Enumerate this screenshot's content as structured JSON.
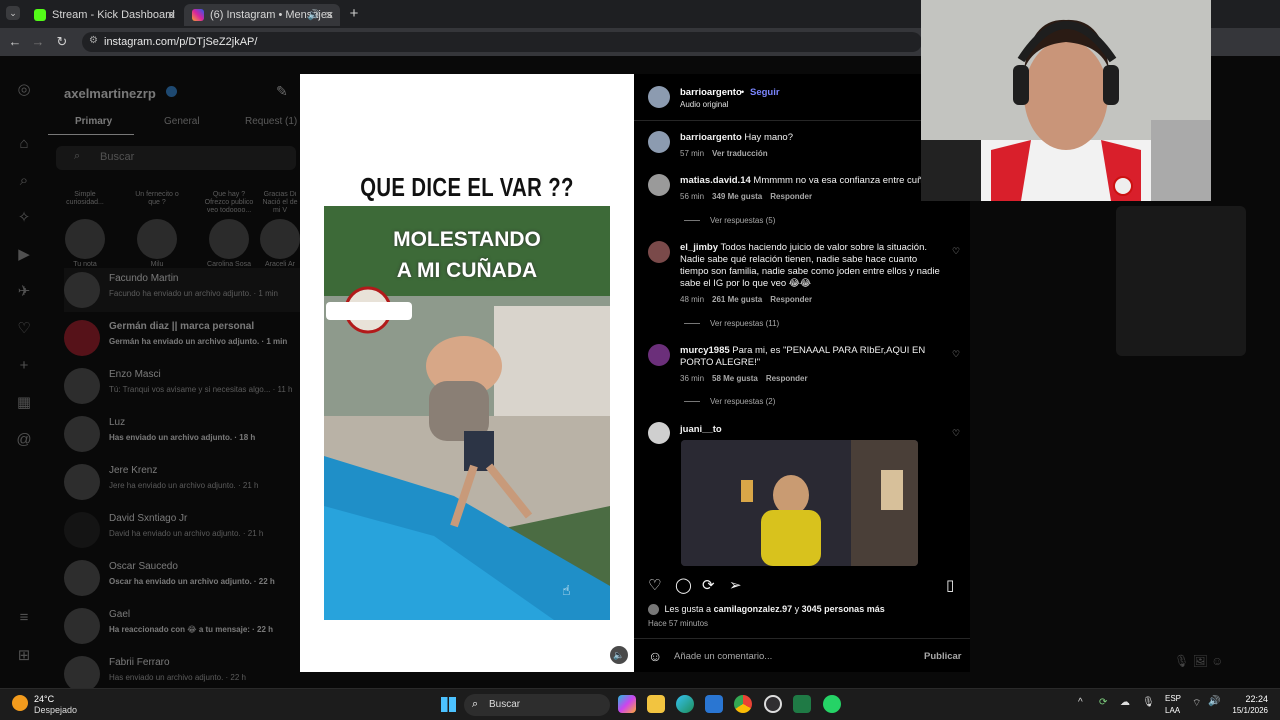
{
  "browser": {
    "tabs": [
      {
        "title": "Stream - Kick Dashboard",
        "active": false,
        "icon_color": "#53fc18"
      },
      {
        "title": "(6) Instagram • Mensajes",
        "active": true,
        "icon_color": "#d6249f"
      }
    ],
    "url": "instagram.com/p/DTjSeZ2jkAP/"
  },
  "dm": {
    "username": "axelmartinezrp",
    "tabs": [
      "Primary",
      "General",
      "Request (1)"
    ],
    "search_placeholder": "Buscar",
    "notes": [
      {
        "text": "Simple curiosidad...",
        "name": "Tu nota"
      },
      {
        "text": "Un fernecito o que ?",
        "name": "Milu"
      },
      {
        "text": "Que hay ? Ofrezco publico veo todoooo...",
        "name": "Carolina Sosa"
      },
      {
        "text": "Gracias Di Nació el de mi V",
        "name": "Araceli Ar"
      }
    ],
    "threads": [
      {
        "name": "Facundo Martin",
        "preview": "Facundo ha enviado un archivo adjunto. · 1 min"
      },
      {
        "name": "Germán diaz || marca personal",
        "preview": "Germán ha enviado un archivo adjunto. · 1 min"
      },
      {
        "name": "Enzo Masci",
        "preview": "Tú: Tranqui vos avisame y si necesitas algo... · 11 h"
      },
      {
        "name": "Luz",
        "preview": "Has enviado un archivo adjunto. · 18 h"
      },
      {
        "name": "Jere Krenz",
        "preview": "Jere ha enviado un archivo adjunto. · 21 h"
      },
      {
        "name": "David Sxntiago Jr",
        "preview": "David ha enviado un archivo adjunto. · 21 h"
      },
      {
        "name": "Oscar Saucedo",
        "preview": "Oscar ha enviado un archivo adjunto. · 22 h"
      },
      {
        "name": "Gael",
        "preview": "Ha reaccionado con 😂 a tu mensaje: · 22 h"
      },
      {
        "name": "Fabrii Ferraro",
        "preview": "Has enviado un archivo adjunto. · 22 h"
      }
    ]
  },
  "post": {
    "media_title": "QUE DICE EL VAR ??",
    "video_title": "MOLESTANDO\nA MI CUÑADA",
    "author": "barrioargento",
    "follow_label": "Seguir",
    "audio": "Audio original",
    "likes_prefix": "Les gusta a",
    "likes_user": "camilagonzalez.97",
    "likes_mid": "y",
    "likes_count": "3045 personas más",
    "posted": "Hace 57 minutos",
    "comment_placeholder": "Añade un comentario...",
    "publish_label": "Publicar"
  },
  "comments": [
    {
      "user": "barrioargento",
      "text": "Hay mano?",
      "time": "57 min",
      "likes": "",
      "action": "Ver traducción",
      "replies": ""
    },
    {
      "user": "matias.david.14",
      "text": "Mmmmm no va esa confianza entre cuñados",
      "time": "56 min",
      "likes": "349 Me gusta",
      "action": "Responder",
      "replies": "Ver respuestas (5)"
    },
    {
      "user": "el_jimby",
      "text": "Todos haciendo juicio de valor sobre la situación. Nadie sabe qué relación tienen, nadie sabe hace cuanto tiempo son familia, nadie sabe como joden entre ellos y nadie sabe el IG por lo que veo 😂😂",
      "time": "48 min",
      "likes": "261 Me gusta",
      "action": "Responder",
      "replies": "Ver respuestas (11)"
    },
    {
      "user": "murcy1985",
      "text": "Para mi, es \"PENAAAL PARA RIbEr,AQUI EN PORTO ALEGRE!\"",
      "time": "36 min",
      "likes": "58 Me gusta",
      "action": "Responder",
      "replies": "Ver respuestas (2)"
    },
    {
      "user": "juani__to",
      "text": "",
      "time": "",
      "likes": "",
      "action": "",
      "replies": ""
    }
  ],
  "taskbar": {
    "weather_temp": "24°C",
    "weather_desc": "Despejado",
    "search_label": "Buscar",
    "lang_top": "ESP",
    "lang_bottom": "LAA",
    "time": "22:24",
    "date": "15/1/2026"
  }
}
